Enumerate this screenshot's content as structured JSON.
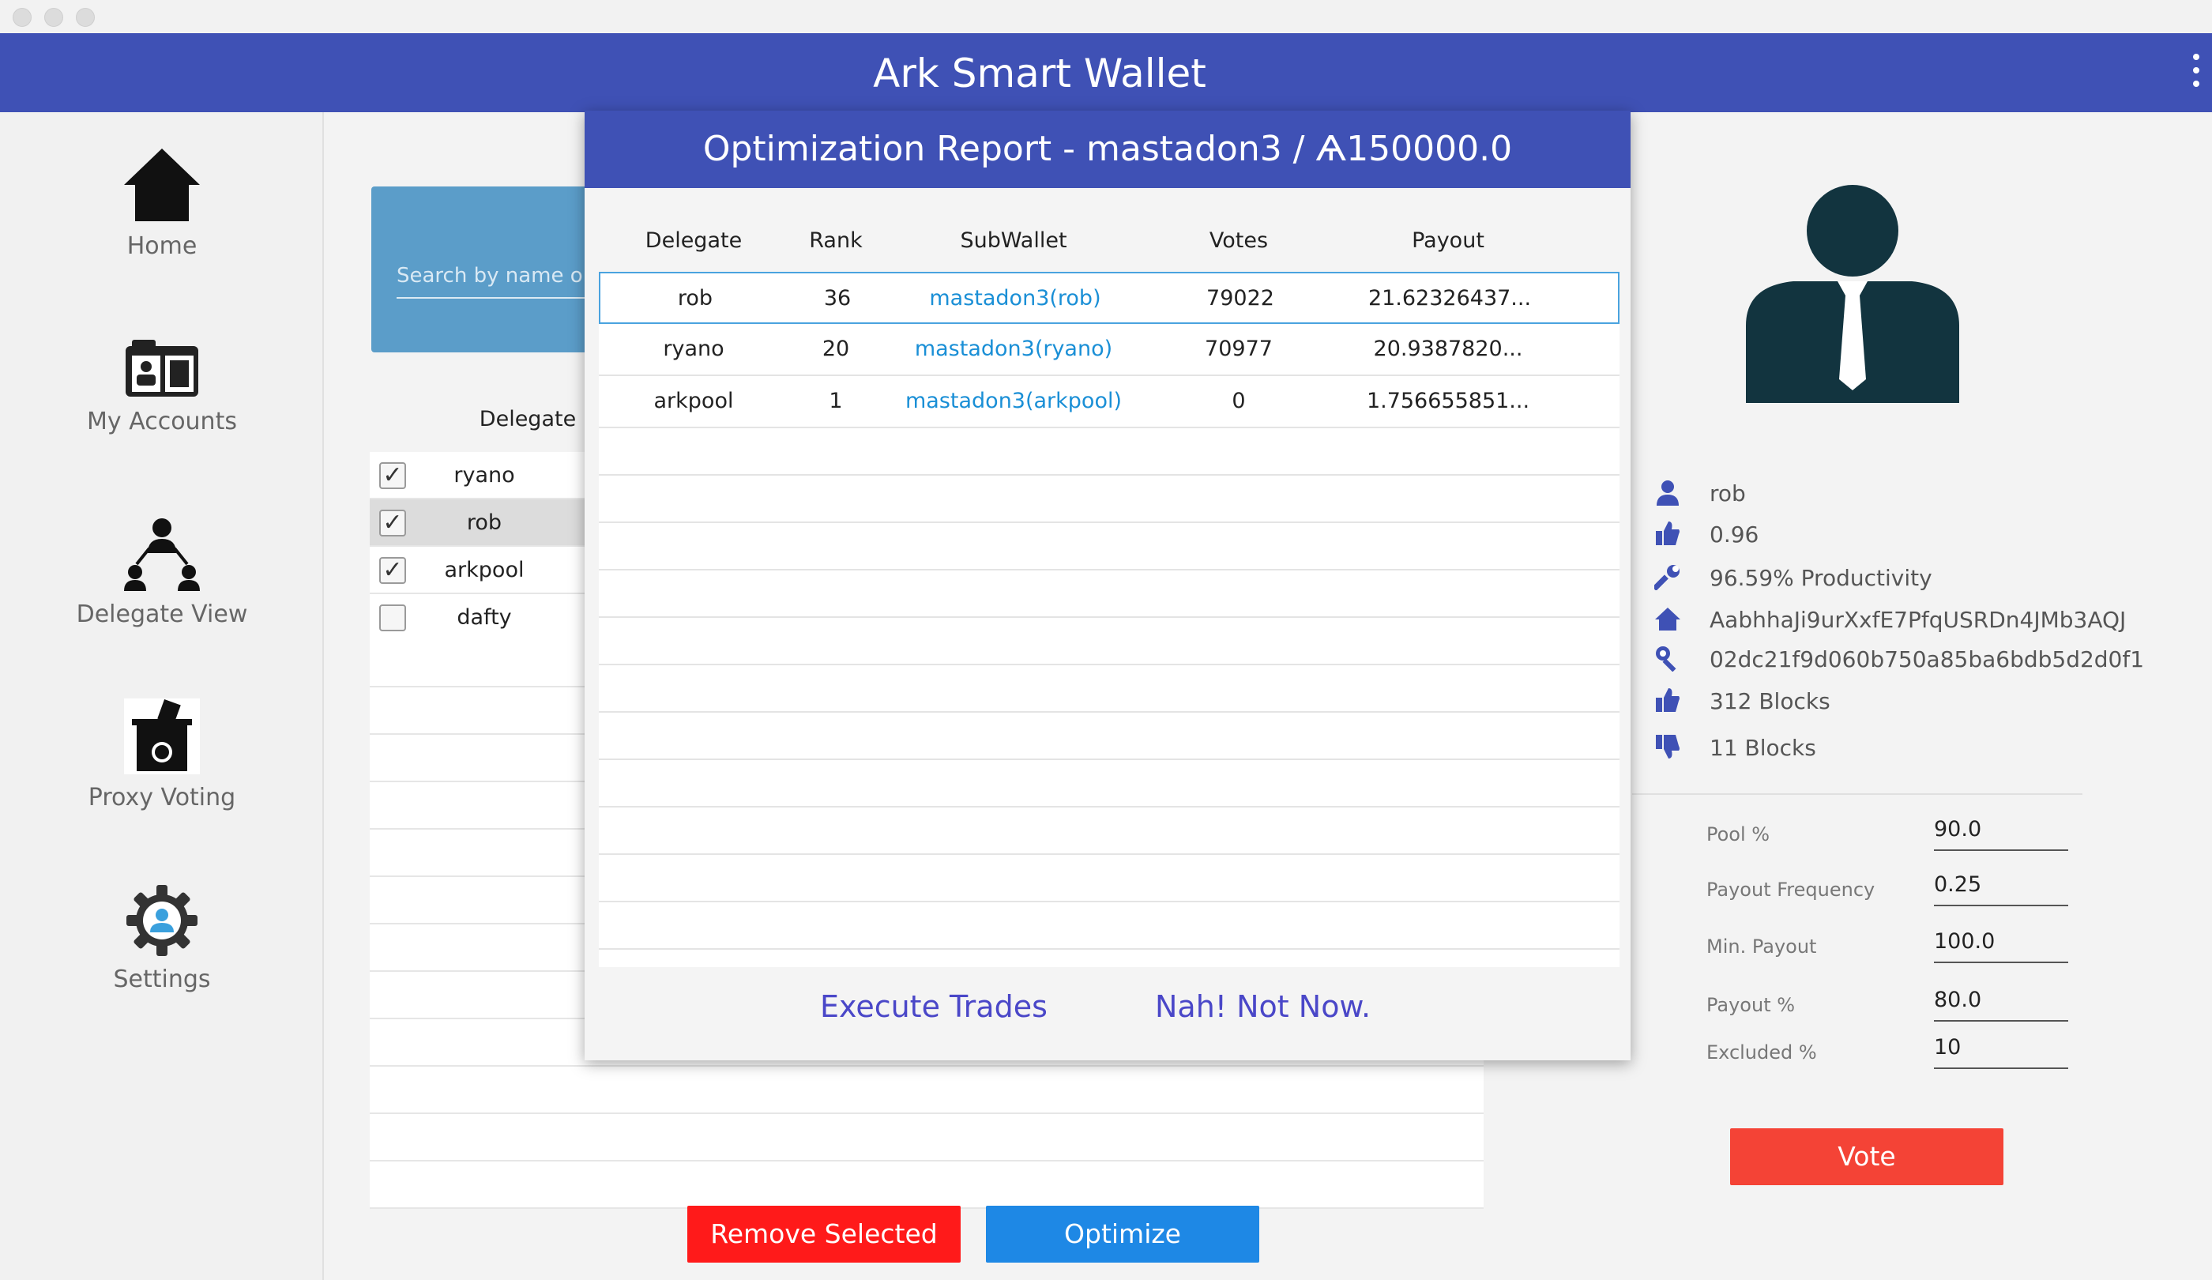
{
  "app": {
    "title": "Ark Smart Wallet"
  },
  "sidebar": {
    "items": [
      {
        "label": "Home",
        "icon": "home-icon"
      },
      {
        "label": "My Accounts",
        "icon": "accounts-icon"
      },
      {
        "label": "Delegate View",
        "icon": "delegate-icon"
      },
      {
        "label": "Proxy Voting",
        "icon": "ballot-box-icon"
      },
      {
        "label": "Settings",
        "icon": "settings-icon"
      }
    ]
  },
  "search": {
    "placeholder": "Search by name or"
  },
  "delegates": {
    "header": "Delegate",
    "rows": [
      {
        "name": "ryano",
        "checked": true
      },
      {
        "name": "rob",
        "checked": true
      },
      {
        "name": "arkpool",
        "checked": true
      },
      {
        "name": "dafty",
        "checked": false
      }
    ]
  },
  "actions": {
    "remove": "Remove Selected",
    "optimize": "Optimize",
    "vote": "Vote"
  },
  "profile": {
    "name": "rob",
    "approval": "0.96",
    "productivity": "96.59% Productivity",
    "address": "AabhhaJi9urXxfE7PfqUSRDn4JMb3AQJ",
    "public_key": "02dc21f9d060b750a85ba6bdb5d2d0f1",
    "forged": "312 Blocks",
    "missed": "11 Blocks"
  },
  "pool": {
    "pool_label": "Pool %",
    "pool_value": "90.0",
    "freq_label": "Payout Frequency",
    "freq_value": "0.25",
    "min_label": "Min. Payout",
    "min_value": "100.0",
    "payout_label": "Payout %",
    "payout_value": "80.0",
    "excluded_label": "Excluded %",
    "excluded_value": "10"
  },
  "report": {
    "title": "Optimization Report - mastadon3 / Ѧ150000.0",
    "columns": [
      "Delegate",
      "Rank",
      "SubWallet",
      "Votes",
      "Payout"
    ],
    "rows": [
      {
        "delegate": "rob",
        "rank": "36",
        "subwallet": "mastadon3(rob)",
        "votes": "79022",
        "payout": "21.62326437..."
      },
      {
        "delegate": "ryano",
        "rank": "20",
        "subwallet": "mastadon3(ryano)",
        "votes": "70977",
        "payout": "20.9387820..."
      },
      {
        "delegate": "arkpool",
        "rank": "1",
        "subwallet": "mastadon3(arkpool)",
        "votes": "0",
        "payout": "1.756655851..."
      }
    ],
    "execute": "Execute Trades",
    "dismiss": "Nah! Not Now."
  },
  "colors": {
    "primary": "#3f51b5",
    "danger": "#ff1a1a",
    "accent": "#1e88e5",
    "link": "#1a8fd6"
  }
}
